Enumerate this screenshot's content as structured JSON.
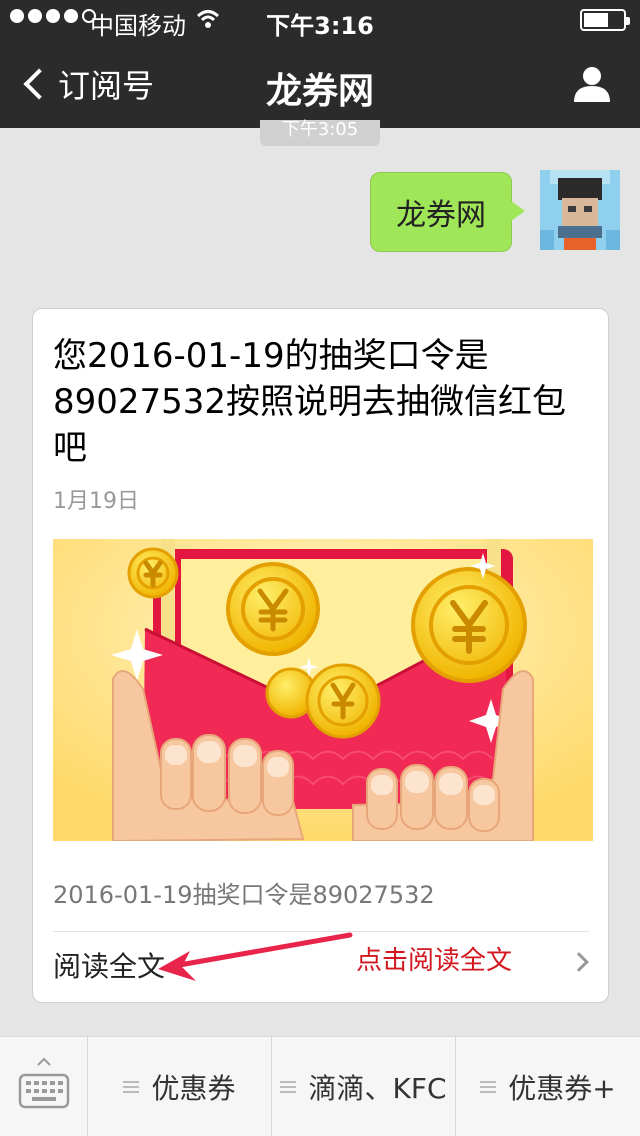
{
  "status_bar": {
    "carrier": "中国移动",
    "time": "下午3:16"
  },
  "nav": {
    "back_label": "订阅号",
    "title": "龙券网",
    "back_icon": "chevron-left-icon",
    "profile_icon": "person-icon"
  },
  "chat": {
    "timestamp": "下午3:05",
    "sent_message": "龙券网"
  },
  "article": {
    "title": "您2016-01-19的抽奖口令是89027532按照说明去抽微信红包吧",
    "date": "1月19日",
    "summary": "2016-01-19抽奖口令是89027532",
    "read_full_label": "阅读全文"
  },
  "annotation": {
    "text": "点击阅读全文",
    "color": "#d2171e"
  },
  "bottom_menu": {
    "keyboard_icon": "keyboard-icon",
    "items": [
      {
        "label": "优惠券"
      },
      {
        "label": "滴滴、KFC"
      },
      {
        "label": "优惠券+"
      }
    ]
  },
  "colors": {
    "nav_background": "#2b2b2b",
    "bubble_green": "#9fe658",
    "annotation_red": "#d2171e"
  }
}
